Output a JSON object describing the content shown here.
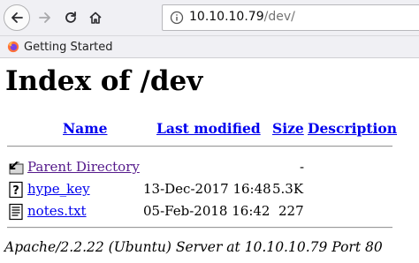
{
  "browser": {
    "url_host": "10.10.10.79",
    "url_path": "/dev/",
    "bookmark": "Getting Started"
  },
  "page": {
    "title": "Index of /dev",
    "columns": {
      "name": "Name",
      "last_modified": "Last modified",
      "size": "Size",
      "description": "Description"
    },
    "rows": [
      {
        "icon": "back-folder-icon",
        "name": "Parent Directory",
        "modified": "",
        "size": "-",
        "description": ""
      },
      {
        "icon": "unknown-file-icon",
        "name": "hype_key",
        "modified": "13-Dec-2017 16:48",
        "size": "5.3K",
        "description": ""
      },
      {
        "icon": "text-file-icon",
        "name": "notes.txt",
        "modified": "05-Feb-2018 16:42",
        "size": "227",
        "description": ""
      }
    ],
    "address": "Apache/2.2.22 (Ubuntu) Server at 10.10.10.79 Port 80"
  }
}
